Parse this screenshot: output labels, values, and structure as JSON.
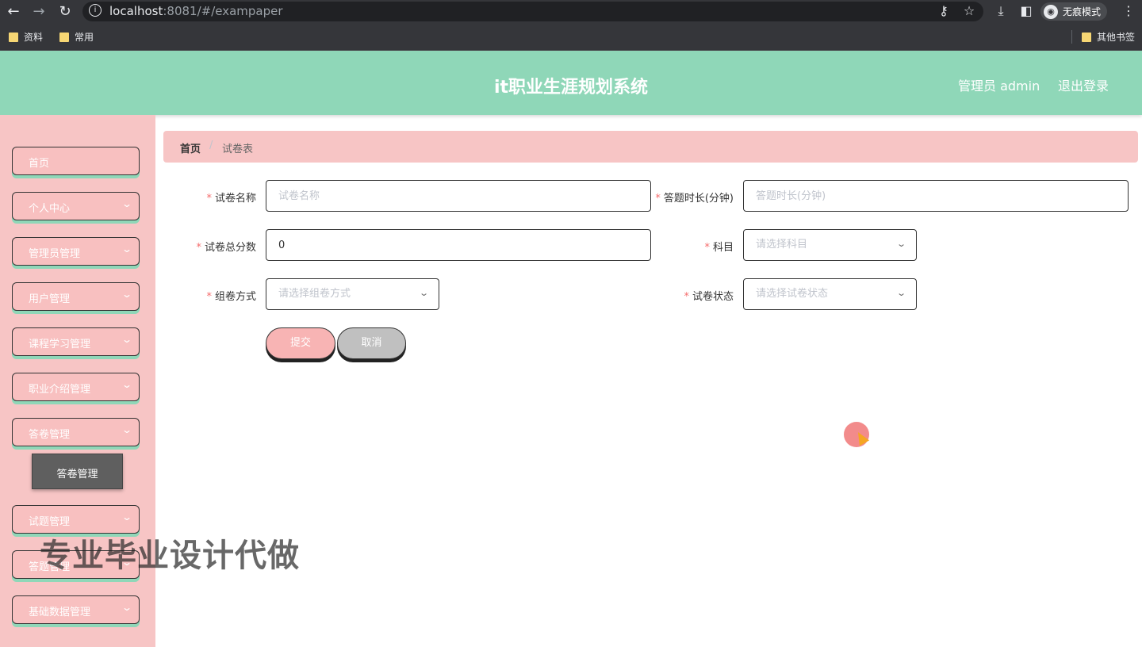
{
  "browser": {
    "url_host": "localhost",
    "url_rest": ":8081/#/exampaper",
    "incognito_label": "无痕模式",
    "bookmarks": [
      "资料",
      "常用"
    ],
    "other_bookmarks": "其他书签"
  },
  "header": {
    "title": "it职业生涯规划系统",
    "user": "管理员 admin",
    "logout": "退出登录"
  },
  "sidebar": {
    "items": [
      {
        "label": "首页",
        "has_children": false
      },
      {
        "label": "个人中心",
        "has_children": true
      },
      {
        "label": "管理员管理",
        "has_children": true
      },
      {
        "label": "用户管理",
        "has_children": true
      },
      {
        "label": "课程学习管理",
        "has_children": true
      },
      {
        "label": "职业介绍管理",
        "has_children": true
      },
      {
        "label": "答卷管理",
        "has_children": true
      },
      {
        "label": "试题管理",
        "has_children": true
      },
      {
        "label": "答题管理",
        "has_children": true
      },
      {
        "label": "基础数据管理",
        "has_children": true
      }
    ],
    "submenu_active": "答卷管理"
  },
  "breadcrumb": {
    "home": "首页",
    "separator": "/",
    "current": "试卷表"
  },
  "form": {
    "paper_name": {
      "label": "试卷名称",
      "placeholder": "试卷名称",
      "value": ""
    },
    "duration": {
      "label": "答题时长(分钟)",
      "placeholder": "答题时长(分钟)",
      "value": ""
    },
    "total_score": {
      "label": "试卷总分数",
      "value": "0"
    },
    "subject": {
      "label": "科目",
      "placeholder": "请选择科目"
    },
    "compose_mode": {
      "label": "组卷方式",
      "placeholder": "请选择组卷方式"
    },
    "status": {
      "label": "试卷状态",
      "placeholder": "请选择试卷状态"
    },
    "required_mark": "*",
    "submit": "提交",
    "cancel": "取消"
  },
  "watermark": "专业毕业设计代做",
  "colors": {
    "header": "#8fd7b8",
    "sidebar": "#f7c5c5",
    "submit_button": "#f8b4b4",
    "cancel_button": "#c0c0c0",
    "required": "#f56c6c"
  }
}
